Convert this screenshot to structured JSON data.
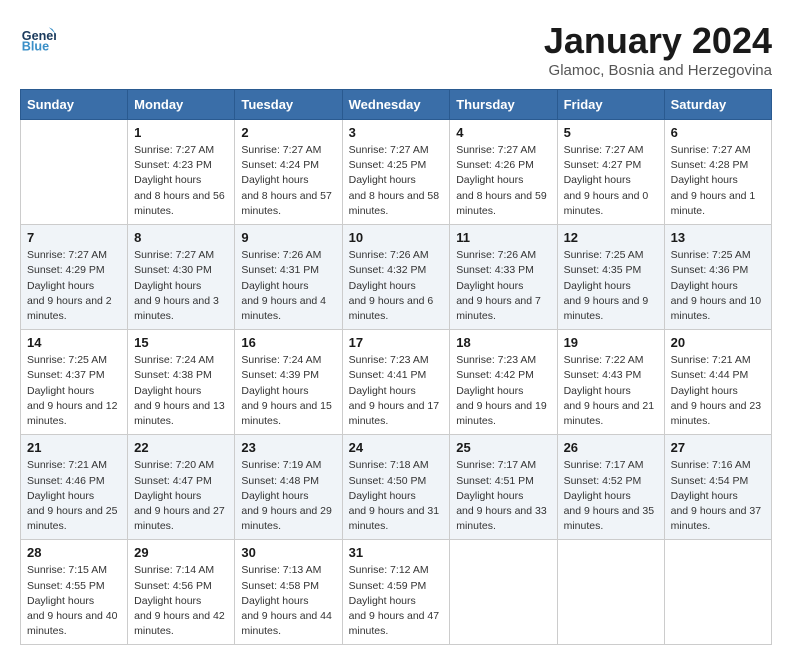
{
  "header": {
    "logo_line1": "General",
    "logo_line2": "Blue",
    "month": "January 2024",
    "location": "Glamoc, Bosnia and Herzegovina"
  },
  "weekdays": [
    "Sunday",
    "Monday",
    "Tuesday",
    "Wednesday",
    "Thursday",
    "Friday",
    "Saturday"
  ],
  "weeks": [
    [
      {
        "day": "",
        "sunrise": "",
        "sunset": "",
        "daylight": ""
      },
      {
        "day": "1",
        "sunrise": "7:27 AM",
        "sunset": "4:23 PM",
        "daylight": "8 hours and 56 minutes."
      },
      {
        "day": "2",
        "sunrise": "7:27 AM",
        "sunset": "4:24 PM",
        "daylight": "8 hours and 57 minutes."
      },
      {
        "day": "3",
        "sunrise": "7:27 AM",
        "sunset": "4:25 PM",
        "daylight": "8 hours and 58 minutes."
      },
      {
        "day": "4",
        "sunrise": "7:27 AM",
        "sunset": "4:26 PM",
        "daylight": "8 hours and 59 minutes."
      },
      {
        "day": "5",
        "sunrise": "7:27 AM",
        "sunset": "4:27 PM",
        "daylight": "9 hours and 0 minutes."
      },
      {
        "day": "6",
        "sunrise": "7:27 AM",
        "sunset": "4:28 PM",
        "daylight": "9 hours and 1 minute."
      }
    ],
    [
      {
        "day": "7",
        "sunrise": "7:27 AM",
        "sunset": "4:29 PM",
        "daylight": "9 hours and 2 minutes."
      },
      {
        "day": "8",
        "sunrise": "7:27 AM",
        "sunset": "4:30 PM",
        "daylight": "9 hours and 3 minutes."
      },
      {
        "day": "9",
        "sunrise": "7:26 AM",
        "sunset": "4:31 PM",
        "daylight": "9 hours and 4 minutes."
      },
      {
        "day": "10",
        "sunrise": "7:26 AM",
        "sunset": "4:32 PM",
        "daylight": "9 hours and 6 minutes."
      },
      {
        "day": "11",
        "sunrise": "7:26 AM",
        "sunset": "4:33 PM",
        "daylight": "9 hours and 7 minutes."
      },
      {
        "day": "12",
        "sunrise": "7:25 AM",
        "sunset": "4:35 PM",
        "daylight": "9 hours and 9 minutes."
      },
      {
        "day": "13",
        "sunrise": "7:25 AM",
        "sunset": "4:36 PM",
        "daylight": "9 hours and 10 minutes."
      }
    ],
    [
      {
        "day": "14",
        "sunrise": "7:25 AM",
        "sunset": "4:37 PM",
        "daylight": "9 hours and 12 minutes."
      },
      {
        "day": "15",
        "sunrise": "7:24 AM",
        "sunset": "4:38 PM",
        "daylight": "9 hours and 13 minutes."
      },
      {
        "day": "16",
        "sunrise": "7:24 AM",
        "sunset": "4:39 PM",
        "daylight": "9 hours and 15 minutes."
      },
      {
        "day": "17",
        "sunrise": "7:23 AM",
        "sunset": "4:41 PM",
        "daylight": "9 hours and 17 minutes."
      },
      {
        "day": "18",
        "sunrise": "7:23 AM",
        "sunset": "4:42 PM",
        "daylight": "9 hours and 19 minutes."
      },
      {
        "day": "19",
        "sunrise": "7:22 AM",
        "sunset": "4:43 PM",
        "daylight": "9 hours and 21 minutes."
      },
      {
        "day": "20",
        "sunrise": "7:21 AM",
        "sunset": "4:44 PM",
        "daylight": "9 hours and 23 minutes."
      }
    ],
    [
      {
        "day": "21",
        "sunrise": "7:21 AM",
        "sunset": "4:46 PM",
        "daylight": "9 hours and 25 minutes."
      },
      {
        "day": "22",
        "sunrise": "7:20 AM",
        "sunset": "4:47 PM",
        "daylight": "9 hours and 27 minutes."
      },
      {
        "day": "23",
        "sunrise": "7:19 AM",
        "sunset": "4:48 PM",
        "daylight": "9 hours and 29 minutes."
      },
      {
        "day": "24",
        "sunrise": "7:18 AM",
        "sunset": "4:50 PM",
        "daylight": "9 hours and 31 minutes."
      },
      {
        "day": "25",
        "sunrise": "7:17 AM",
        "sunset": "4:51 PM",
        "daylight": "9 hours and 33 minutes."
      },
      {
        "day": "26",
        "sunrise": "7:17 AM",
        "sunset": "4:52 PM",
        "daylight": "9 hours and 35 minutes."
      },
      {
        "day": "27",
        "sunrise": "7:16 AM",
        "sunset": "4:54 PM",
        "daylight": "9 hours and 37 minutes."
      }
    ],
    [
      {
        "day": "28",
        "sunrise": "7:15 AM",
        "sunset": "4:55 PM",
        "daylight": "9 hours and 40 minutes."
      },
      {
        "day": "29",
        "sunrise": "7:14 AM",
        "sunset": "4:56 PM",
        "daylight": "9 hours and 42 minutes."
      },
      {
        "day": "30",
        "sunrise": "7:13 AM",
        "sunset": "4:58 PM",
        "daylight": "9 hours and 44 minutes."
      },
      {
        "day": "31",
        "sunrise": "7:12 AM",
        "sunset": "4:59 PM",
        "daylight": "9 hours and 47 minutes."
      },
      {
        "day": "",
        "sunrise": "",
        "sunset": "",
        "daylight": ""
      },
      {
        "day": "",
        "sunrise": "",
        "sunset": "",
        "daylight": ""
      },
      {
        "day": "",
        "sunrise": "",
        "sunset": "",
        "daylight": ""
      }
    ]
  ]
}
